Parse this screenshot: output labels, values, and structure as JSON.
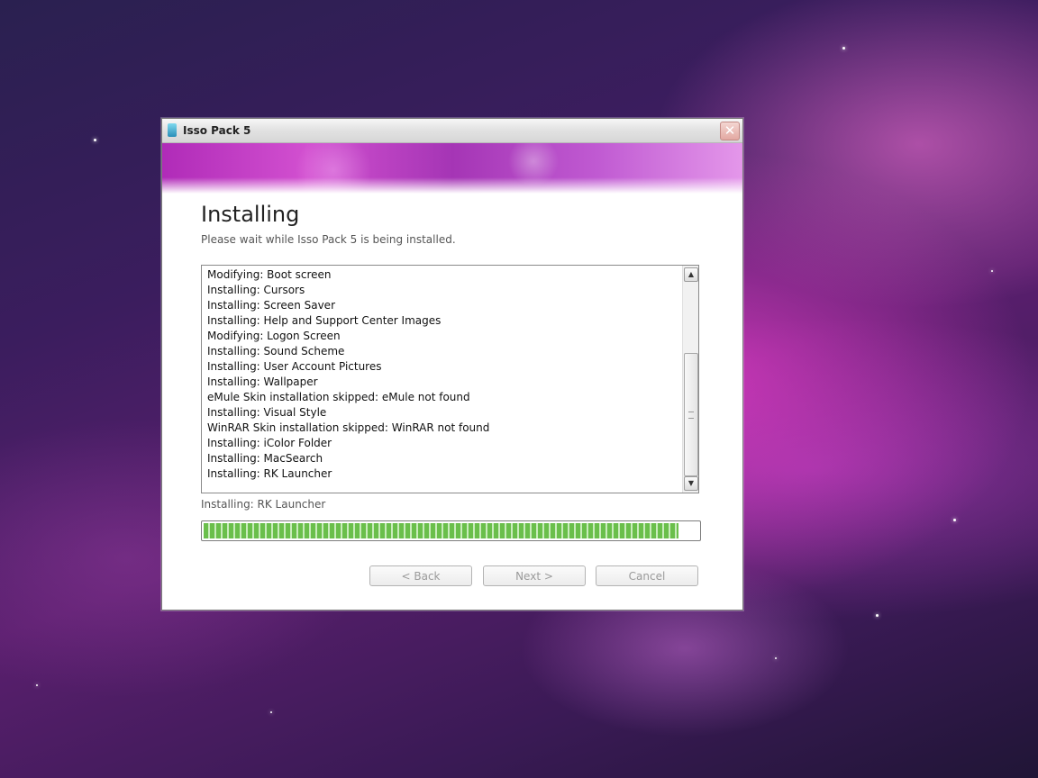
{
  "window": {
    "title": "Isso Pack 5",
    "close_glyph": "✕"
  },
  "page": {
    "heading": "Installing",
    "subtitle": "Please wait while Isso Pack 5 is being installed."
  },
  "log": {
    "lines": [
      "Modifying: Boot screen",
      "Installing: Cursors",
      "Installing: Screen Saver",
      "Installing: Help and Support Center Images",
      "Modifying: Logon Screen",
      "Installing: Sound Scheme",
      "Installing: User Account Pictures",
      "Installing: Wallpaper",
      "eMule Skin installation skipped: eMule not found",
      "Installing: Visual Style",
      "WinRAR Skin installation skipped: WinRAR not found",
      "Installing: iColor Folder",
      "Installing: MacSearch",
      "Installing: RK Launcher"
    ]
  },
  "status": {
    "current": "Installing: RK Launcher",
    "progress": 0.96
  },
  "buttons": {
    "back": "< Back",
    "next": "Next >",
    "cancel": "Cancel"
  },
  "colors": {
    "progress_green": "#6abf4b",
    "banner_magenta": "#b02bb8",
    "disabled_text": "#9a9a9a"
  },
  "icons": {
    "app": "installer-app-icon",
    "close": "close-icon",
    "scroll_up": "scroll-up-icon",
    "scroll_down": "scroll-down-icon"
  }
}
